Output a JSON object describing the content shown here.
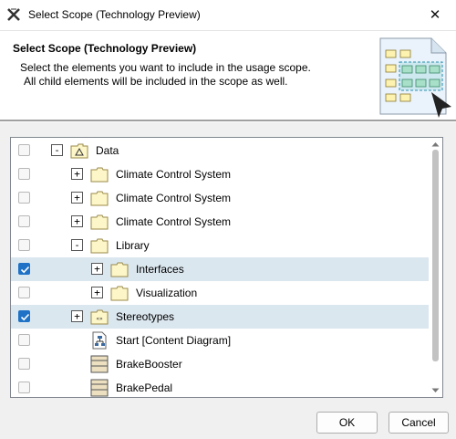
{
  "window": {
    "title": "Select Scope (Technology Preview)",
    "close_glyph": "✕"
  },
  "header": {
    "title": "Select Scope (Technology Preview)",
    "description_line1": "Select the elements you want to include in the usage scope.",
    "description_line2": "All child elements will be included in the scope as well."
  },
  "tree": {
    "rows": [
      {
        "label": "Data",
        "checked": false,
        "selected": false,
        "expander": "-",
        "icon": "package-icon",
        "depth": 0
      },
      {
        "label": "Climate Control System",
        "checked": false,
        "selected": false,
        "expander": "+",
        "icon": "folder-icon",
        "depth": 1
      },
      {
        "label": "Climate Control System",
        "checked": false,
        "selected": false,
        "expander": "+",
        "icon": "folder-icon",
        "depth": 1
      },
      {
        "label": "Climate Control System",
        "checked": false,
        "selected": false,
        "expander": "+",
        "icon": "folder-icon",
        "depth": 1
      },
      {
        "label": "Library",
        "checked": false,
        "selected": false,
        "expander": "-",
        "icon": "folder-icon",
        "depth": 1
      },
      {
        "label": "Interfaces",
        "checked": true,
        "selected": true,
        "expander": "+",
        "icon": "folder-icon",
        "depth": 2
      },
      {
        "label": "Visualization",
        "checked": false,
        "selected": false,
        "expander": "+",
        "icon": "folder-icon",
        "depth": 2
      },
      {
        "label": "Stereotypes",
        "checked": true,
        "selected": true,
        "expander": "+",
        "icon": "stereotype-package-icon",
        "depth": 1
      },
      {
        "label": "Start [Content Diagram]",
        "checked": false,
        "selected": false,
        "expander": "",
        "icon": "content-diagram-icon",
        "depth": 1
      },
      {
        "label": "BrakeBooster",
        "checked": false,
        "selected": false,
        "expander": "",
        "icon": "block-icon",
        "depth": 1
      },
      {
        "label": "BrakePedal",
        "checked": false,
        "selected": false,
        "expander": "",
        "icon": "block-icon",
        "depth": 1
      }
    ]
  },
  "buttons": {
    "ok": "OK",
    "cancel": "Cancel"
  },
  "colors": {
    "selection": "#dbe7ef",
    "checkbox_checked": "#1f72c6",
    "folder_fill": "#fdf6c8",
    "folder_stroke": "#9a8a4a"
  }
}
